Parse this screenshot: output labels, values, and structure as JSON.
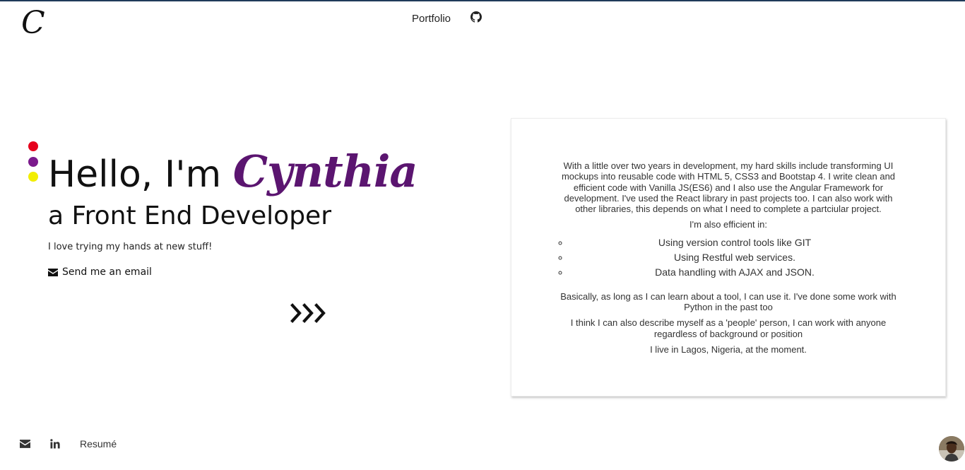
{
  "header": {
    "logo_text": "C",
    "nav_portfolio": "Portfolio",
    "github_icon": "github-icon"
  },
  "hero": {
    "greeting": "Hello, I'm ",
    "name": "Cynthia",
    "subtitle": "a Front End Developer",
    "note": "I love trying my hands at new stuff!",
    "email_label": "Send me an email",
    "dot_colors": [
      "#e6001c",
      "#7b1a8c",
      "#f2ee00"
    ],
    "arrow_icon": "triple-chevron-right-icon"
  },
  "about": {
    "intro": "With a little over two years in development, my hard skills include transforming UI mockups into reusable code with HTML 5, CSS3 and Bootstap 4. I write clean and efficient code with Vanilla JS(ES6) and I also use the Angular Framework for development. I've used the React library in past projects too. I can also work with other libraries, this depends on what I need to complete a partciular project.",
    "efficient_heading": "I'm also efficient in:",
    "skills": [
      "Using version control tools like GIT",
      "Using Restful web services.",
      "Data handling with AJAX and JSON."
    ],
    "learn": "Basically, as long as I can learn about a tool, I can use it. I've done some work with Python in the past too",
    "people": "I think I can also describe myself as a 'people' person, I can work with anyone regardless of background or position",
    "location": "I live in Lagos, Nigeria, at the moment."
  },
  "footer": {
    "email_icon": "envelope-icon",
    "linkedin_icon": "linkedin-icon",
    "resume_label": "Resumé",
    "avatar": "avatar"
  },
  "colors": {
    "accent": "#5b1570",
    "top_border": "#1f3a5a"
  }
}
